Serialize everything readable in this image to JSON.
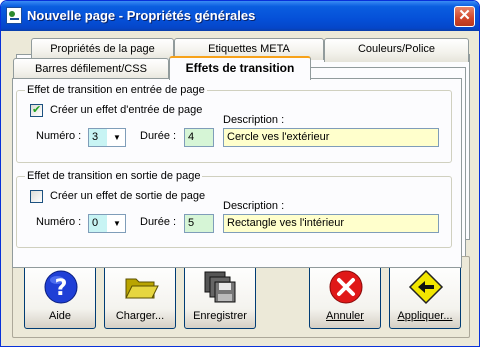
{
  "window": {
    "title": "Nouvelle page - Propriétés générales",
    "close_glyph": "✕"
  },
  "tabs": {
    "row_back": [
      "Propriétés de la page",
      "Etiquettes META",
      "Couleurs/Police"
    ],
    "row_front": [
      "Barres défilement/CSS",
      "Effets de transition"
    ],
    "active": "Effets de transition"
  },
  "entry": {
    "legend": "Effet de transition en entrée de page",
    "checkbox_label": "Créer un effet d'entrée de page",
    "checked": true,
    "number_label": "Numéro :",
    "number_value": "3",
    "duration_label": "Durée :",
    "duration_value": "4",
    "description_label": "Description :",
    "description_value": "Cercle ves l'extérieur"
  },
  "exit": {
    "legend": "Effet de transition en sortie de page",
    "checkbox_label": "Créer un effet de sortie de page",
    "checked": false,
    "number_label": "Numéro :",
    "number_value": "0",
    "duration_label": "Durée :",
    "duration_value": "5",
    "description_label": "Description :",
    "description_value": "Rectangle ves l'intérieur"
  },
  "buttons": {
    "help": "Aide",
    "load": "Charger...",
    "save": "Enregistrer",
    "cancel": "Annuler",
    "apply": "Appliquer..."
  },
  "icons": {
    "app": "app-page-icon",
    "help": "help-question-icon",
    "load": "open-folder-icon",
    "save": "floppy-disks-icon",
    "cancel": "cancel-x-icon",
    "apply": "apply-arrow-sign-icon"
  },
  "colors": {
    "title_bar": "#0550d8",
    "active_tab_accent": "#f7a21a",
    "number_field": "#c8f4f4",
    "duration_field": "#d6f5d6",
    "description_field": "#ffffcc"
  }
}
